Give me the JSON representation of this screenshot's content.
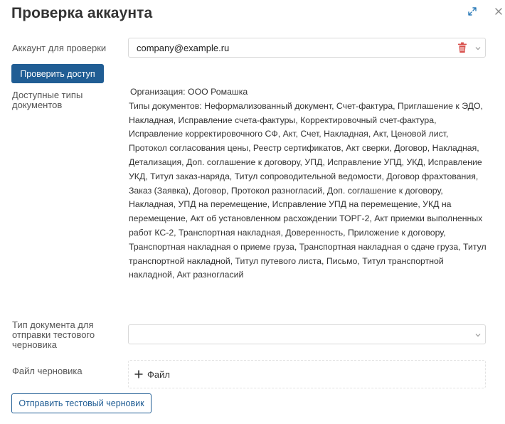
{
  "dialog": {
    "title": "Проверка аккаунта"
  },
  "account": {
    "label": "Аккаунт для проверки",
    "value": "company@example.ru"
  },
  "check_button": "Проверить доступ",
  "doc_types": {
    "label": "Доступные типы документов",
    "organization": "Организация: ООО Ромашка",
    "types_text": "Типы документов: Неформализованный документ, Счет-фактура, Приглашение к ЭДО, Накладная, Исправление счета-фактуры, Корректировочный счет-фактура, Исправление корректировочного СФ, Акт, Счет, Накладная, Акт, Ценовой лист, Протокол согласования цены, Реестр сертификатов, Акт сверки, Договор, Накладная, Детализация, Доп. соглашение к договору, УПД, Исправление УПД, УКД, Исправление УКД, Титул заказ-наряда, Титул сопроводительной ведомости, Договор фрахтования, Заказ (Заявка), Договор, Протокол разногласий, Доп. соглашение к договору, Накладная, УПД на перемещение, Исправление УПД на перемещение, УКД на перемещение, Акт об установленном расхождении ТОРГ-2, Акт приемки выполненных работ КС-2, Транспортная накладная, Доверенность, Приложение к договору, Транспортная накладная о приеме груза, Транспортная накладная о сдаче груза, Титул транспортной накладной, Титул путевого листа, Письмо, Титул транспортной накладной, Акт разногласий"
  },
  "test_doc_type": {
    "label": "Тип документа для отправки тестового черновика",
    "value": ""
  },
  "draft_file": {
    "label": "Файл черновика",
    "add_label": "Файл"
  },
  "send_button": "Отправить тестовый черновик",
  "colors": {
    "primary": "#205d94",
    "danger": "#d9534f"
  }
}
